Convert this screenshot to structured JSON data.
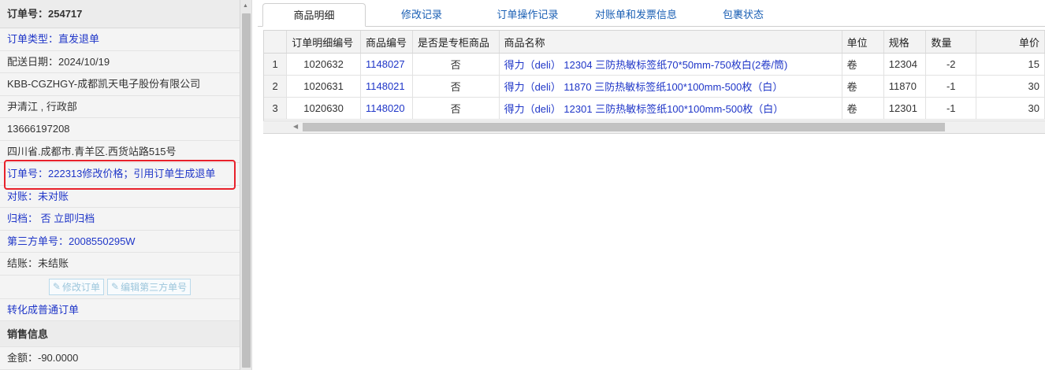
{
  "left": {
    "order_no": "订单号：254717",
    "rows": [
      "订单类型：直发退单",
      "配送日期：2024/10/19",
      "KBB-CGZHGY-成都凯天电子股份有限公司",
      "尹清江 , 行政部",
      "13666197208",
      "四川省.成都市.青羊区.西货站路515号",
      "订单号：222313修改价格；引用订单生成退单",
      "对账：未对账",
      "归档： 否 立即归档",
      "第三方单号：2008550295W",
      "结账：未结账"
    ],
    "buttons": {
      "modify_order": "修改订单",
      "edit_third_party": "编辑第三方单号"
    },
    "convert_link": "转化成普通订单",
    "sales_section": "销售信息",
    "amount": "金额：-90.0000"
  },
  "tabs": [
    "商品明细",
    "修改记录",
    "订单操作记录",
    "对账单和发票信息",
    "包裹状态"
  ],
  "grid": {
    "headers": [
      "",
      "订单明细编号",
      "商品编号",
      "是否是专柜商品",
      "商品名称",
      "单位",
      "规格",
      "数量",
      "单价"
    ],
    "rows": [
      [
        "1",
        "1020632",
        "1148027",
        "否",
        "得力（deli） 12304 三防热敏标签纸70*50mm-750枚白(2卷/筒)",
        "卷",
        "12304",
        "-2",
        "15"
      ],
      [
        "2",
        "1020631",
        "1148021",
        "否",
        "得力（deli） 11870 三防热敏标签纸100*100mm-500枚（白）",
        "卷",
        "11870",
        "-1",
        "30"
      ],
      [
        "3",
        "1020630",
        "1148020",
        "否",
        "得力（deli） 12301 三防热敏标签纸100*100mm-500枚（白）",
        "卷",
        "12301",
        "-1",
        "30"
      ]
    ]
  }
}
